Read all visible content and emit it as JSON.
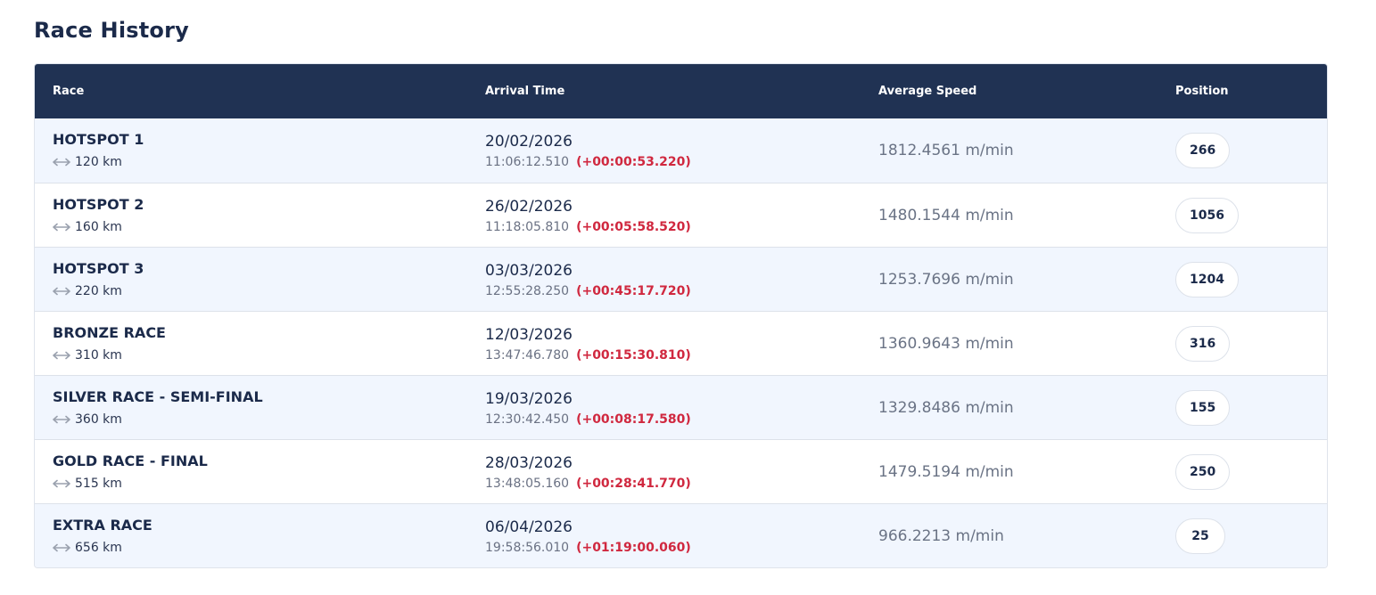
{
  "page": {
    "title": "Race History"
  },
  "table": {
    "headers": {
      "race": "Race",
      "arrival": "Arrival Time",
      "speed": "Average Speed",
      "position": "Position"
    },
    "rows": [
      {
        "name": "HOTSPOT 1",
        "distance": "120 km",
        "date": "20/02/2026",
        "time": "11:06:12.510",
        "delta": "(+00:00:53.220)",
        "speed": "1812.4561 m/min",
        "position": "266"
      },
      {
        "name": "HOTSPOT 2",
        "distance": "160 km",
        "date": "26/02/2026",
        "time": "11:18:05.810",
        "delta": "(+00:05:58.520)",
        "speed": "1480.1544 m/min",
        "position": "1056"
      },
      {
        "name": "HOTSPOT 3",
        "distance": "220 km",
        "date": "03/03/2026",
        "time": "12:55:28.250",
        "delta": "(+00:45:17.720)",
        "speed": "1253.7696 m/min",
        "position": "1204"
      },
      {
        "name": "BRONZE RACE",
        "distance": "310 km",
        "date": "12/03/2026",
        "time": "13:47:46.780",
        "delta": "(+00:15:30.810)",
        "speed": "1360.9643 m/min",
        "position": "316"
      },
      {
        "name": "SILVER RACE - SEMI-FINAL",
        "distance": "360 km",
        "date": "19/03/2026",
        "time": "12:30:42.450",
        "delta": "(+00:08:17.580)",
        "speed": "1329.8486 m/min",
        "position": "155"
      },
      {
        "name": "GOLD RACE - FINAL",
        "distance": "515 km",
        "date": "28/03/2026",
        "time": "13:48:05.160",
        "delta": "(+00:28:41.770)",
        "speed": "1479.5194 m/min",
        "position": "250"
      },
      {
        "name": "EXTRA RACE",
        "distance": "656 km",
        "date": "06/04/2026",
        "time": "19:58:56.010",
        "delta": "(+01:19:00.060)",
        "speed": "966.2213 m/min",
        "position": "25"
      }
    ]
  },
  "icons": {
    "distance": "double-arrow-icon"
  },
  "colors": {
    "header_bg": "#203253",
    "row_alt_bg": "#f1f6fe",
    "delta_red": "#d0283f"
  }
}
